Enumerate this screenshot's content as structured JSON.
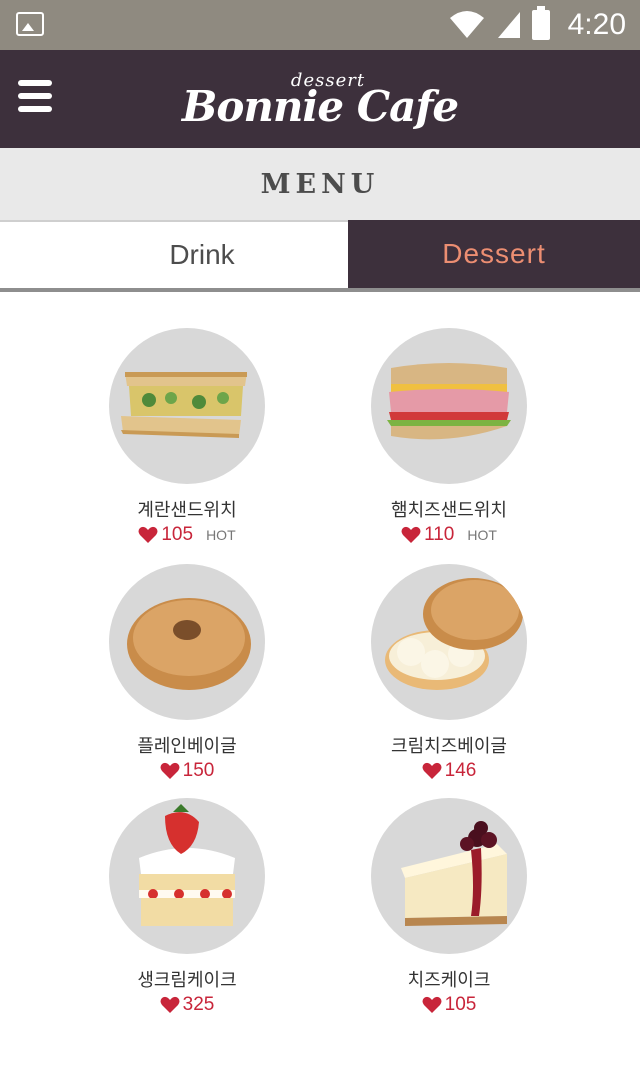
{
  "status_bar": {
    "time": "4:20"
  },
  "header": {
    "logo_small": "dessert",
    "logo_big": "Bonnie Cafe"
  },
  "menu": {
    "title": "MENU"
  },
  "tabs": [
    {
      "label": "Drink",
      "active": false
    },
    {
      "label": "Dessert",
      "active": true
    }
  ],
  "items": [
    {
      "name": "계란샌드위치",
      "likes": "105",
      "badge": "HOT",
      "icon": "egg-sandwich-image"
    },
    {
      "name": "햄치즈샌드위치",
      "likes": "110",
      "badge": "HOT",
      "icon": "ham-cheese-sandwich-image"
    },
    {
      "name": "플레인베이글",
      "likes": "150",
      "badge": "",
      "icon": "plain-bagel-image"
    },
    {
      "name": "크림치즈베이글",
      "likes": "146",
      "badge": "",
      "icon": "cream-cheese-bagel-image"
    },
    {
      "name": "생크림케이크",
      "likes": "325",
      "badge": "",
      "icon": "strawberry-cream-cake-image"
    },
    {
      "name": "치즈케이크",
      "likes": "105",
      "badge": "",
      "icon": "cheesecake-image"
    }
  ],
  "colors": {
    "header": "#3d303c",
    "accent": "#ec8e72",
    "heart": "#c8253a",
    "status_bar": "#8f8a80"
  }
}
